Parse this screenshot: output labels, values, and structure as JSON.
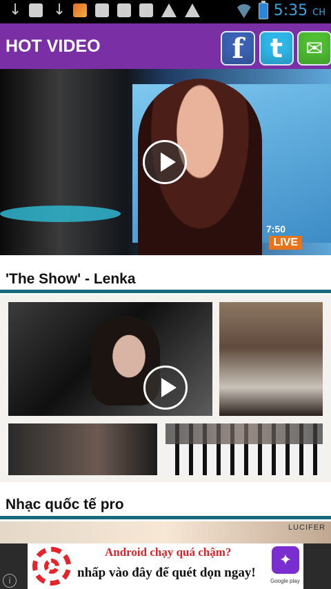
{
  "status_bar": {
    "time": "5:35",
    "ampm": "CH"
  },
  "header": {
    "title": "HOT VIDEO",
    "share": {
      "facebook_glyph": "f",
      "twitter_glyph": "t",
      "mail_glyph": "✉"
    }
  },
  "videos": [
    {
      "caption": "'The Show' - Lenka",
      "overlay_time": "7:50",
      "overlay_badge": "LIVE"
    },
    {
      "caption": "Nhạc quốc tế pro"
    },
    {
      "overlay_label": "LUCIFER"
    }
  ],
  "ad": {
    "line1": "Android chạy quá chậm?",
    "line2": "nhấp vào đây để quét dọn ngay!",
    "store_label": "Google play",
    "info_glyph": "i"
  },
  "colors": {
    "header_bg": "#7b2fa4",
    "divider": "#176a7a",
    "clock": "#3aa6e0"
  }
}
